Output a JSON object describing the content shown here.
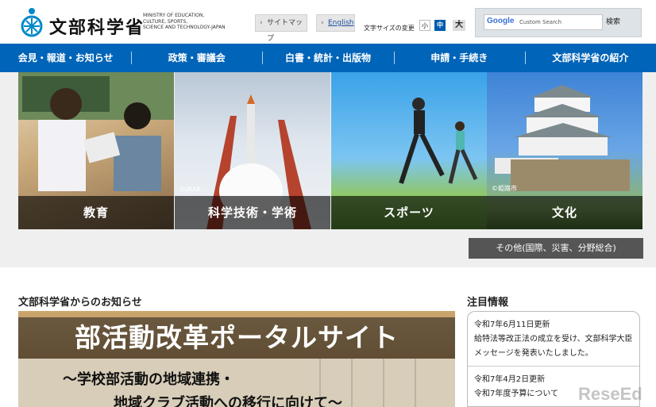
{
  "header": {
    "logo_ja": "文部科学省",
    "logo_en": [
      "MINISTRY OF EDUCATION,",
      "CULTURE, SPORTS,",
      "SCIENCE AND TECHNOLOGY-JAPAN"
    ],
    "sitemap_label": "サイトマップ",
    "english_label": "English",
    "font_size_label": "文字サイズの変更",
    "font_small": "小",
    "font_medium": "中",
    "font_large": "大",
    "search": {
      "google_logo": "Google",
      "placeholder": "Custom Search",
      "button_label": "検索"
    }
  },
  "nav": [
    "会見・報道・お知らせ",
    "政策・審議会",
    "白書・統計・出版物",
    "申請・手続き",
    "文部科学省の紹介"
  ],
  "tiles": [
    {
      "label": "教育",
      "credit": ""
    },
    {
      "label": "科学技術・学術",
      "credit": "©JAXA"
    },
    {
      "label": "スポーツ",
      "credit": ""
    },
    {
      "label": "文化",
      "credit": "©姫路市"
    }
  ],
  "other_button": "その他(国際、災害、分野総合)",
  "news": {
    "title": "文部科学省からのお知らせ",
    "banner_title": "部活動改革ポータルサイト",
    "banner_sub1": "～学校部活動の地域連携・",
    "banner_sub2": "地域クラブ活動への移行に向けて～"
  },
  "attention": {
    "title": "注目情報",
    "items": [
      {
        "date": "令和7年6月11日更新",
        "text": "給特法等改正法の成立を受け、文部科学大臣メッセージを発表いたしました。"
      },
      {
        "date": "令和7年4月2日更新",
        "text": "令和7年度予算について"
      }
    ]
  },
  "watermark": "ReseEd",
  "colors": {
    "nav_blue": "#0064b8",
    "tile_caption": "#000000",
    "other_button": "#555555"
  }
}
